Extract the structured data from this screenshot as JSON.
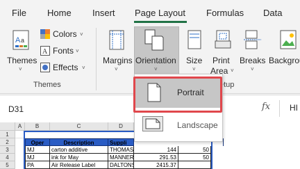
{
  "tabs": [
    {
      "label": "File"
    },
    {
      "label": "Home"
    },
    {
      "label": "Insert"
    },
    {
      "label": "Page Layout",
      "active": true
    },
    {
      "label": "Formulas"
    },
    {
      "label": "Data"
    }
  ],
  "ribbon": {
    "themes": {
      "label": "Themes",
      "chevron": "˅"
    },
    "colors": {
      "label": "Colors",
      "chevron": "˅"
    },
    "fonts": {
      "label": "Fonts",
      "chevron": "˅"
    },
    "effects": {
      "label": "Effects",
      "chevron": "˅"
    },
    "themes_group_label": "Themes",
    "margins": {
      "label": "Margins",
      "chevron": "˅"
    },
    "orientation": {
      "label": "Orientation",
      "chevron": "˅"
    },
    "size": {
      "label": "Size",
      "chevron": "˅"
    },
    "print_area": {
      "line1": "Print",
      "line2": "Area",
      "chevron": "˅"
    },
    "breaks": {
      "label": "Breaks",
      "chevron": "˅"
    },
    "background": {
      "label": "Backgrou"
    },
    "page_setup_group_label_partial": "etup"
  },
  "orientation_menu": {
    "portrait": "Portrait",
    "landscape": "Landscape"
  },
  "formula_bar": {
    "name_box": "D31",
    "fx": "fx",
    "value_partial": "HI"
  },
  "sheet": {
    "columns": [
      "A",
      "B",
      "C",
      "D"
    ],
    "rows": [
      "1",
      "2",
      "3",
      "4",
      "5"
    ],
    "header_row": [
      "Oper",
      "Description",
      "Suppli"
    ],
    "data": [
      [
        "MJ",
        "carton additive",
        "THOMAS S",
        "144",
        "50"
      ],
      [
        "MJ",
        "ink for May",
        "MANNERS",
        "291.53",
        "50"
      ],
      [
        "PA",
        "Air Release Label",
        "DALTONS",
        "2415.37",
        ""
      ]
    ]
  },
  "colors": {
    "accent": "#217346",
    "highlight": "#c6c6c6",
    "annotation_red": "#e0474c",
    "table_header_blue": "#2a5cc4"
  },
  "icons": [
    "themes-icon",
    "colors-icon",
    "fonts-icon",
    "effects-icon",
    "margins-icon",
    "orientation-icon",
    "size-icon",
    "print-area-icon",
    "breaks-icon",
    "background-icon",
    "portrait-page-icon",
    "landscape-page-icon",
    "fx-icon"
  ]
}
